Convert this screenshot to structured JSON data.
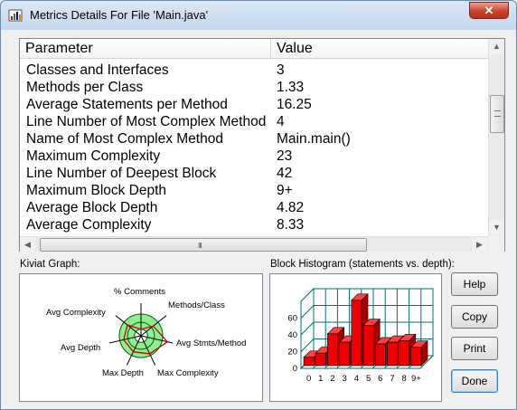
{
  "window": {
    "title": "Metrics Details For File 'Main.java'",
    "close_glyph": "✕"
  },
  "table": {
    "columns": [
      "Parameter",
      "Value"
    ],
    "rows": [
      {
        "parameter": "Classes and Interfaces",
        "value": "3"
      },
      {
        "parameter": "Methods per Class",
        "value": "1.33"
      },
      {
        "parameter": "Average Statements per Method",
        "value": "16.25"
      },
      {
        "parameter": "Line Number of Most Complex Method",
        "value": "4"
      },
      {
        "parameter": "Name of Most Complex Method",
        "value": "Main.main()"
      },
      {
        "parameter": "Maximum Complexity",
        "value": "23"
      },
      {
        "parameter": "Line Number of Deepest Block",
        "value": "42"
      },
      {
        "parameter": "Maximum Block Depth",
        "value": "9+"
      },
      {
        "parameter": "Average Block Depth",
        "value": "4.82"
      },
      {
        "parameter": "Average Complexity",
        "value": "8.33"
      }
    ],
    "scroll_up_glyph": "▲",
    "scroll_down_glyph": "▼",
    "scroll_left_glyph": "◀",
    "scroll_right_glyph": "▶",
    "h_grip": "III"
  },
  "kiviat": {
    "label": "Kiviat Graph:",
    "axes": [
      "% Comments",
      "Methods/Class",
      "Avg Stmts/Method",
      "Max Complexity",
      "Max Depth",
      "Avg Depth",
      "Avg Complexity"
    ],
    "values": [
      0.3,
      0.72,
      1.25,
      0.92,
      0.82,
      0.82,
      0.8
    ],
    "colors": {
      "ring_fill": "#90ee90",
      "ring_stroke": "#006400",
      "polygon": "#cc0000",
      "axis": "#000000"
    }
  },
  "histogram": {
    "label": "Block Histogram (statements vs. depth):",
    "bar_color": "#ee0000",
    "grid_color": "#007070"
  },
  "chart_data": {
    "type": "bar",
    "title": "Block Histogram (statements vs. depth):",
    "categories": [
      "0",
      "1",
      "2",
      "3",
      "4",
      "5",
      "6",
      "7",
      "8",
      "9+"
    ],
    "values": [
      10,
      15,
      38,
      28,
      78,
      48,
      26,
      28,
      30,
      22
    ],
    "yticks": [
      "0",
      "20",
      "40",
      "60"
    ],
    "ylim": [
      0,
      80
    ],
    "grid": true
  },
  "buttons": {
    "help": "Help",
    "copy": "Copy",
    "print": "Print",
    "done": "Done"
  }
}
